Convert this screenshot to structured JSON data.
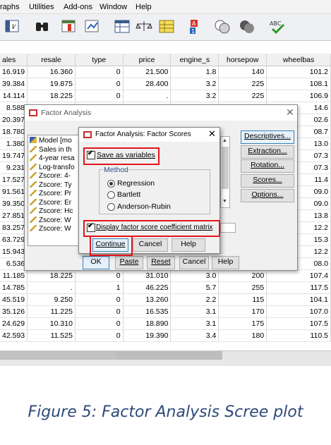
{
  "menu": [
    "raphs",
    "Utilities",
    "Add-ons",
    "Window",
    "Help"
  ],
  "columns": [
    "ales",
    "resale",
    "type",
    "price",
    "engine_s",
    "horsepow",
    "wheelbas"
  ],
  "rows_top": [
    [
      "16.919",
      "16.360",
      "0",
      "21.500",
      "1.8",
      "140",
      "101.2"
    ],
    [
      "39.384",
      "19.875",
      "0",
      "28.400",
      "3.2",
      "225",
      "108.1"
    ],
    [
      "14.114",
      "18.225",
      "0",
      ".",
      "3.2",
      "225",
      "106.9"
    ]
  ],
  "rows_left_partial": [
    "8.588",
    "20.397",
    "18.780",
    "1.380",
    "19.747",
    "9.231",
    "17.527",
    "91.561",
    "39.350",
    "27.851",
    "83.257",
    "63.729",
    "15.943",
    "6.536"
  ],
  "rows_right_partial": [
    "14.6",
    "02.6",
    "08.7",
    "13.0",
    "07.3",
    "07.3",
    "11.4",
    "09.0",
    "09.0",
    "13.8",
    "12.2",
    "15.3",
    "12.2",
    "08.0"
  ],
  "rows_bottom": [
    [
      "11.185",
      "18.225",
      "0",
      "31.010",
      "3.0",
      "200",
      "107.4"
    ],
    [
      "14.785",
      ".",
      "1",
      "46.225",
      "5.7",
      "255",
      "117.5"
    ],
    [
      "45.519",
      "9.250",
      "0",
      "13.260",
      "2.2",
      "115",
      "104.1"
    ],
    [
      "35.126",
      "11.225",
      "0",
      "16.535",
      "3.1",
      "170",
      "107.0"
    ],
    [
      "24.629",
      "10.310",
      "0",
      "18.890",
      "3.1",
      "175",
      "107.5"
    ],
    [
      "42.593",
      "11.525",
      "0",
      "19.390",
      "3.4",
      "180",
      "110.5"
    ]
  ],
  "factor_analysis": {
    "title": "Factor Analysis",
    "variables": [
      "Model [mo",
      "Sales in th",
      "4-year resa",
      "Log-transfo",
      "Zscore:  4-",
      "Zscore:  Ty",
      "Zscore:  Pr",
      "Zscore:  Er",
      "Zscore:  Hc",
      "Zscore:  W",
      "Zscore:  W"
    ],
    "side_buttons": [
      "Descriptives...",
      "Extraction...",
      "Rotation...",
      "Scores...",
      "Options..."
    ],
    "bottom_buttons": [
      "OK",
      "Paste",
      "Reset",
      "Cancel",
      "Help"
    ]
  },
  "factor_scores": {
    "title": "Factor Analysis: Factor Scores",
    "save_label": "Save as variables",
    "method_label": "Method",
    "methods": [
      "Regression",
      "Bartlett",
      "Anderson-Rubin"
    ],
    "display_label": "Display factor score coefficient matrix",
    "buttons": [
      "Continue",
      "Cancel",
      "Help"
    ]
  },
  "caption": "Figure 5: Factor Analysis Scree plot"
}
